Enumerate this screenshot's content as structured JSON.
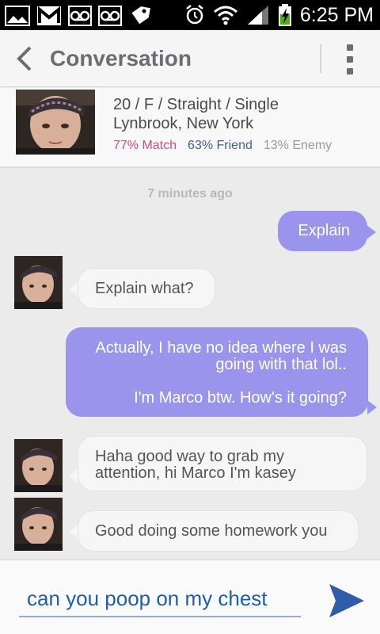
{
  "status_bar": {
    "time": "6:25 PM"
  },
  "header": {
    "title": "Conversation"
  },
  "profile": {
    "details": "20 / F / Straight / Single",
    "location": "Lynbrook, New York",
    "match": "77% Match",
    "friend": "63% Friend",
    "enemy": "13% Enemy"
  },
  "timestamp": "7 minutes ago",
  "messages": [
    {
      "direction": "out",
      "text_lines": [
        "Explain"
      ]
    },
    {
      "direction": "in",
      "text_lines": [
        "Explain what?"
      ]
    },
    {
      "direction": "out",
      "text_lines": [
        "Actually, I have no idea where I was",
        "going with that lol..",
        "",
        "I'm Marco btw. How's it going?"
      ]
    },
    {
      "direction": "in",
      "text_lines": [
        "Haha good way to grab my",
        "attention, hi Marco I'm kasey"
      ]
    },
    {
      "direction": "in",
      "text_lines": [
        "Good doing some homework you"
      ]
    }
  ],
  "composer": {
    "value": "can you poop on my chest"
  },
  "colors": {
    "outgoing_bubble": "#9b94ec",
    "match": "#e8457a",
    "friend": "#3a5fa8",
    "accent": "#2f5da8"
  }
}
